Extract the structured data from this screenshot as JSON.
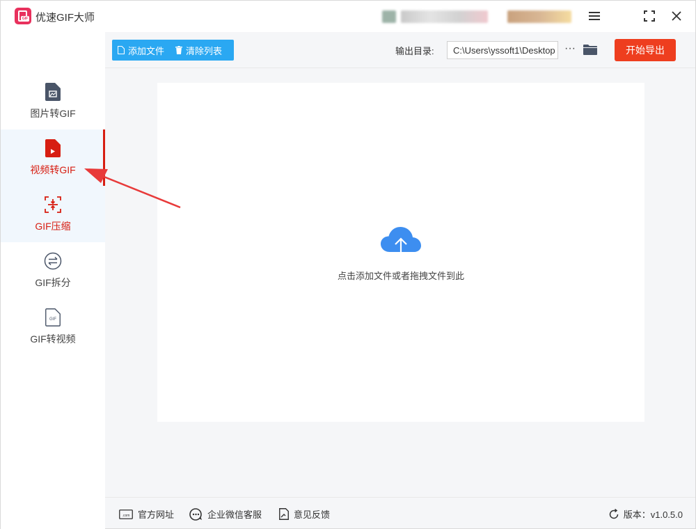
{
  "window": {
    "title": "优速GIF大师",
    "controls": [
      "menu-icon",
      "maximize-icon",
      "close-icon"
    ]
  },
  "sidebar": {
    "items": [
      {
        "label": "图片转GIF",
        "icon": "image-file-icon"
      },
      {
        "label": "视频转GIF",
        "icon": "video-file-icon",
        "active": true
      },
      {
        "label": "GIF压缩",
        "icon": "compress-icon"
      },
      {
        "label": "GIF拆分",
        "icon": "split-icon"
      },
      {
        "label": "GIF转视频",
        "icon": "gif-file-icon"
      }
    ]
  },
  "toolbar": {
    "add_file_label": "添加文件",
    "clear_list_label": "清除列表",
    "output_dir_label": "输出目录:",
    "output_dir_value": "C:\\Users\\yssoft1\\Desktop",
    "browse_label": "···",
    "export_label": "开始导出"
  },
  "dropzone": {
    "hint": "点击添加文件或者拖拽文件到此"
  },
  "footer": {
    "website_label": "官方网址",
    "wechat_label": "企业微信客服",
    "feedback_label": "意见反馈",
    "version_label": "版本：v1.0.5.0"
  },
  "colors": {
    "accent_blue": "#2aa8f2",
    "accent_red": "#d71e12",
    "export_red": "#ee3e1f",
    "logo_pink": "#e8315d"
  }
}
